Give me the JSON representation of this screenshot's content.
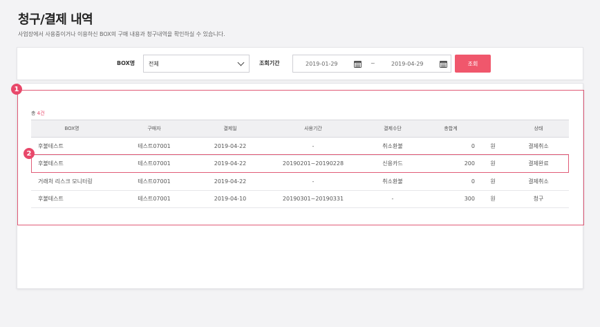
{
  "page": {
    "title": "청구/결제 내역",
    "description": "사업장에서 사용중이거나 이용하신 BOX의 구매 내용과 청구내역을 확인하실 수 있습니다."
  },
  "filter": {
    "box_label": "BOX명",
    "box_value": "전체",
    "period_label": "조회기간",
    "start_date": "2019-01-29",
    "range_separator": "~",
    "end_date": "2019-04-29",
    "search_label": "조회"
  },
  "annotations": {
    "marker1": "1",
    "marker2": "2"
  },
  "results": {
    "total_prefix": "총 ",
    "total_count": "4건",
    "columns": [
      "BOX명",
      "구매자",
      "결제일",
      "사용기간",
      "결제수단",
      "총합계",
      "",
      "상태"
    ],
    "rows": [
      {
        "box": "후불테스트",
        "buyer": "테스트07001",
        "date": "2019-04-22",
        "period": "-",
        "method": "취소환불",
        "amount": "0",
        "unit": "원",
        "status": "결제취소"
      },
      {
        "box": "후불테스트",
        "buyer": "테스트07001",
        "date": "2019-04-22",
        "period": "20190201~20190228",
        "method": "신용카드",
        "amount": "200",
        "unit": "원",
        "status": "결제완료"
      },
      {
        "box": "거래처 리스크 모니터링",
        "buyer": "테스트07001",
        "date": "2019-04-22",
        "period": "-",
        "method": "취소환불",
        "amount": "0",
        "unit": "원",
        "status": "결제취소"
      },
      {
        "box": "후불테스트",
        "buyer": "테스트07001",
        "date": "2019-04-10",
        "period": "20190301~20190331",
        "method": "-",
        "amount": "300",
        "unit": "원",
        "status": "청구"
      }
    ]
  },
  "colors": {
    "accent": "#f0576c",
    "marker": "#e8486a",
    "highlight_border": "#e05a76"
  },
  "icons": {
    "calendar": "calendar-icon",
    "dropdown": "chevron-down-icon"
  }
}
